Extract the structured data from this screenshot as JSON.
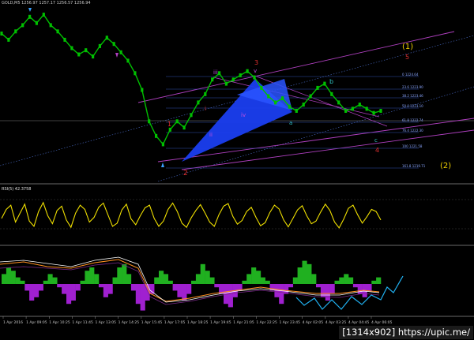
{
  "header": {
    "ohlc": "GOLD,M5  1256.97 1257.17 1256.57 1256.94"
  },
  "rsi": {
    "label": "RSI(5) 42.3758"
  },
  "wave_labels": [
    {
      "text": "(1)",
      "color": "#f0d000"
    },
    {
      "text": "5",
      "color": "#e03030"
    },
    {
      "text": "(2)",
      "color": "#f0d000"
    },
    {
      "text": "3",
      "color": "#e03030"
    },
    {
      "text": "v",
      "color": "#c050e0"
    },
    {
      "text": "iii",
      "color": "#c050e0"
    },
    {
      "text": "i",
      "color": "#e03030"
    },
    {
      "text": "1",
      "color": "#e03030"
    },
    {
      "text": "2",
      "color": "#e03030"
    },
    {
      "text": "ii",
      "color": "#c050e0"
    },
    {
      "text": "iv",
      "color": "#c050e0"
    },
    {
      "text": "a",
      "color": "#30c0c0"
    },
    {
      "text": "b",
      "color": "#30c0c0"
    },
    {
      "text": "c",
      "color": "#30c0c0"
    },
    {
      "text": "4",
      "color": "#e03030"
    }
  ],
  "fib_levels": [
    "0 1224.64",
    "23.6 1223.90",
    "38.2 1223.46",
    "50.0 1223.10",
    "61.8 1222.74",
    "76.4 1222.30",
    "100 1221.58",
    "161.8 1219.71"
  ],
  "watermark": "[1314x902] https://upic.me/",
  "chart_data": {
    "type": "line",
    "title": "",
    "symbol": "GOLD",
    "timeframe": "M5",
    "ohlc": {
      "open": 1256.97,
      "high": 1257.17,
      "low": 1256.57,
      "close": 1256.94
    },
    "x_tick_labels": [
      "1 Apr 2016",
      "1 Apr 09:05",
      "1 Apr 10:25",
      "1 Apr 11:45",
      "1 Apr 13:05",
      "1 Apr 14:25",
      "1 Apr 15:45",
      "1 Apr 17:05",
      "1 Apr 18:25",
      "1 Apr 19:45",
      "1 Apr 21:05",
      "1 Apr 22:25",
      "1 Apr 23:45",
      "4 Apr 02:05",
      "4 Apr 03:25",
      "4 Apr 04:45",
      "4 Apr 06:05"
    ],
    "price_series": {
      "name": "",
      "color": "#00c000",
      "values": [
        1226.5,
        1226.2,
        1226.6,
        1226.9,
        1227.3,
        1227.0,
        1227.4,
        1226.9,
        1226.6,
        1226.2,
        1225.8,
        1225.5,
        1225.7,
        1225.4,
        1225.9,
        1226.3,
        1226.0,
        1225.6,
        1225.2,
        1224.6,
        1223.8,
        1222.3,
        1221.6,
        1221.2,
        1221.9,
        1222.3,
        1222.0,
        1222.6,
        1223.2,
        1223.6,
        1224.3,
        1224.6,
        1224.1,
        1224.3,
        1224.5,
        1224.7,
        1224.4,
        1223.9,
        1223.5,
        1223.2,
        1223.4,
        1223.0,
        1222.8,
        1223.1,
        1223.5,
        1223.9,
        1224.1,
        1223.6,
        1223.2,
        1222.8,
        1222.9,
        1223.1,
        1222.9,
        1222.7,
        1222.8
      ]
    },
    "fib_retracement": [
      {
        "level": "0",
        "price": 1224.64
      },
      {
        "level": "23.6",
        "price": 1223.9
      },
      {
        "level": "38.2",
        "price": 1223.46
      },
      {
        "level": "50.0",
        "price": 1223.1
      },
      {
        "level": "61.8",
        "price": 1222.74
      },
      {
        "level": "76.4",
        "price": 1222.3
      },
      {
        "level": "100",
        "price": 1221.58
      },
      {
        "level": "161.8",
        "price": 1219.71
      }
    ],
    "rsi": {
      "name": "RSI(5)",
      "last": 42.3758,
      "color": "#f0e000",
      "values": [
        45,
        62,
        70,
        38,
        55,
        72,
        40,
        30,
        58,
        75,
        50,
        35,
        60,
        68,
        42,
        28,
        55,
        70,
        62,
        38,
        47,
        66,
        74,
        52,
        30,
        36,
        61,
        72,
        44,
        33,
        50,
        65,
        70,
        45,
        30,
        40,
        62,
        74,
        58,
        36,
        28,
        46,
        60,
        71,
        55,
        38,
        30,
        52,
        68,
        73,
        49,
        34,
        41,
        58,
        66,
        47,
        31,
        37,
        56,
        70,
        63,
        42,
        29,
        45,
        61,
        69,
        50,
        35,
        40,
        57,
        72,
        60,
        38,
        27,
        44,
        64,
        70,
        52,
        36,
        48,
        62,
        58,
        42
      ]
    },
    "macd_histogram": {
      "positive_color": "#20b020",
      "negative_color": "#a020d0",
      "values": [
        3,
        5,
        4,
        2,
        1,
        -2,
        -5,
        -4,
        -2,
        1,
        3,
        2,
        -1,
        -3,
        -6,
        -5,
        -2,
        1,
        4,
        5,
        3,
        -1,
        -4,
        -3,
        2,
        5,
        6,
        3,
        -2,
        -6,
        -8,
        -5,
        -3,
        2,
        4,
        3,
        1,
        -2,
        -4,
        -5,
        -3,
        1,
        3,
        6,
        4,
        2,
        -1,
        -3,
        -6,
        -7,
        -4,
        -2,
        1,
        3,
        5,
        4,
        2,
        1,
        -2,
        -4,
        -6,
        -3,
        -1,
        2,
        5,
        7,
        6,
        3,
        -1,
        -4,
        -5,
        -3,
        1,
        2,
        3,
        2,
        -1,
        -3,
        -4,
        -2,
        1,
        2
      ]
    }
  }
}
